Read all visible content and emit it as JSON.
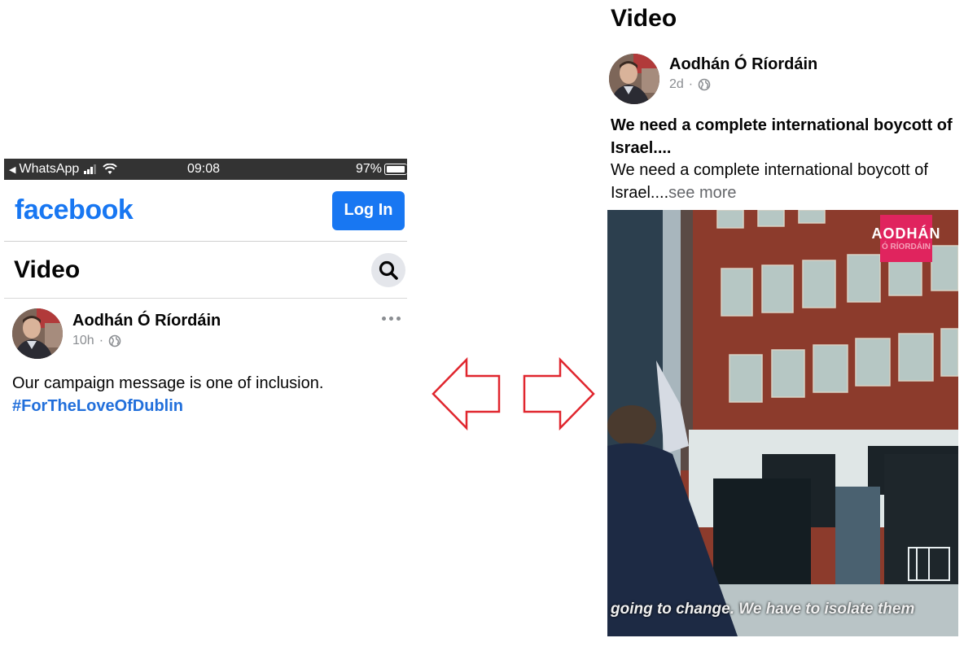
{
  "left": {
    "status_bar": {
      "back_app": "WhatsApp",
      "time": "09:08",
      "battery": "97%",
      "battery_level": 0.97
    },
    "header": {
      "logo": "facebook",
      "login_label": "Log In"
    },
    "section": {
      "title": "Video",
      "search_icon": "search-icon"
    },
    "post": {
      "author": "Aodhán Ó Ríordáin",
      "age": "10h",
      "separator": "·",
      "privacy_icon": "globe-icon",
      "text": "Our campaign message is one of inclusion.",
      "hashtag": "#ForTheLoveOfDublin"
    }
  },
  "arrows": {
    "left_icon": "arrow-left-icon",
    "right_icon": "arrow-right-icon",
    "color": "#e0262e"
  },
  "right": {
    "section_title": "Video",
    "post": {
      "author": "Aodhán Ó Ríordáin",
      "age": "2d",
      "separator": "·",
      "privacy_icon": "globe-icon",
      "headline": "We need a complete international boycott of Israel....",
      "body": "We need a complete international boycott of Israel....",
      "see_more": "see more"
    },
    "video": {
      "watermark_line1": "AODHÁN",
      "watermark_line2": "Ó RÍORDÁIN",
      "subtitle": "going to change. We have to isolate them"
    }
  },
  "colors": {
    "facebook_blue": "#1877f2",
    "hashtag_blue": "#216fdb",
    "watermark_pink": "#e0245e"
  }
}
